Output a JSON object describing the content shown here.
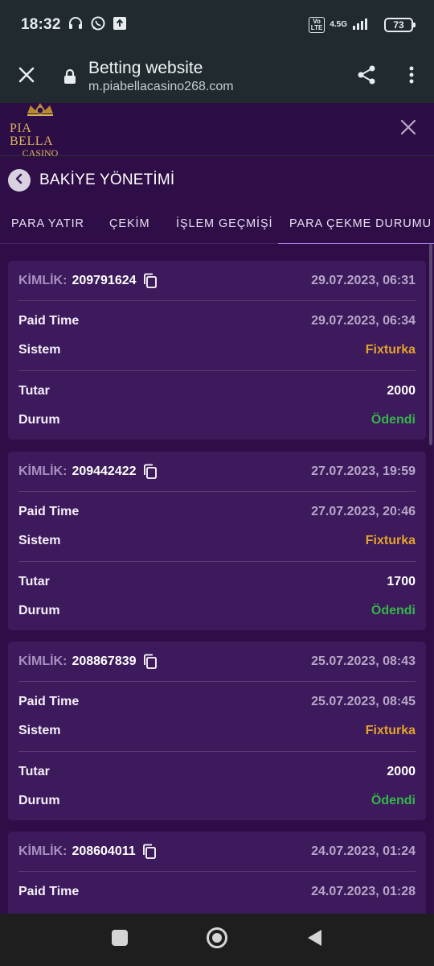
{
  "status_bar": {
    "time": "18:32",
    "volte": "Vo LTE",
    "network": "4.5G",
    "battery": "73"
  },
  "browser": {
    "title": "Betting website",
    "url": "m.piabellacasino268.com"
  },
  "site": {
    "logo_text": "PIA BELLA",
    "logo_sub": "CASINO",
    "accent": "#2f0e48"
  },
  "page": {
    "title": "BAKİYE YÖNETİMİ"
  },
  "tabs": [
    {
      "label": "PARA YATIR"
    },
    {
      "label": "ÇEKİM"
    },
    {
      "label": "İŞLEM GEÇMİŞİ"
    },
    {
      "label": "PARA ÇEKME DURUMU",
      "active": true
    }
  ],
  "labels": {
    "kimlik": "KİMLİK:",
    "paid_time": "Paid Time",
    "sistem": "Sistem",
    "tutar": "Tutar",
    "durum": "Durum"
  },
  "withdrawals": [
    {
      "id": "209791624",
      "date": "29.07.2023, 06:31",
      "paid_time": "29.07.2023, 06:34",
      "system": "Fixturka",
      "amount": "2000",
      "status": "Ödendi"
    },
    {
      "id": "209442422",
      "date": "27.07.2023, 19:59",
      "paid_time": "27.07.2023, 20:46",
      "system": "Fixturka",
      "amount": "1700",
      "status": "Ödendi"
    },
    {
      "id": "208867839",
      "date": "25.07.2023, 08:43",
      "paid_time": "25.07.2023, 08:45",
      "system": "Fixturka",
      "amount": "2000",
      "status": "Ödendi"
    },
    {
      "id": "208604011",
      "date": "24.07.2023, 01:24",
      "paid_time": "24.07.2023, 01:28",
      "system": "",
      "amount": "",
      "status": ""
    }
  ],
  "colors": {
    "system": "#e2a32e",
    "status_paid": "#35b64a"
  }
}
